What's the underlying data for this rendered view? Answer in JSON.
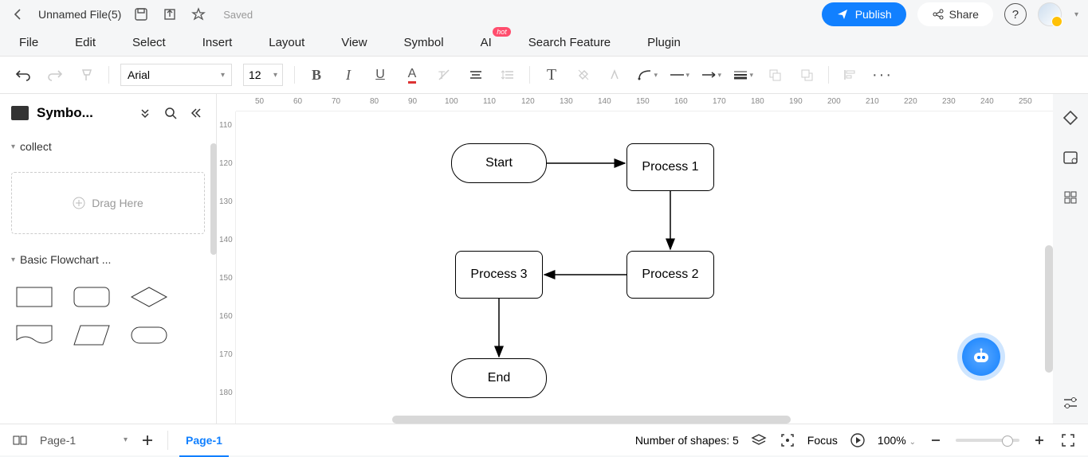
{
  "titlebar": {
    "filename": "Unnamed File(5)",
    "saved_label": "Saved",
    "publish_label": "Publish",
    "share_label": "Share"
  },
  "menu": {
    "items": [
      "File",
      "Edit",
      "Select",
      "Insert",
      "Layout",
      "View",
      "Symbol",
      "AI",
      "Search Feature",
      "Plugin"
    ],
    "ai_badge": "hot"
  },
  "toolbar": {
    "font_name": "Arial",
    "font_size": "12"
  },
  "left_panel": {
    "title": "Symbo...",
    "sections": {
      "collect": "collect",
      "drag_here": "Drag Here",
      "basic_flowchart": "Basic Flowchart ..."
    }
  },
  "ruler_h": [
    "50",
    "60",
    "70",
    "80",
    "90",
    "100",
    "110",
    "120",
    "130",
    "140",
    "150",
    "160",
    "170",
    "180",
    "190",
    "200",
    "210",
    "220",
    "230",
    "240",
    "250"
  ],
  "ruler_v": [
    "110",
    "120",
    "130",
    "140",
    "150",
    "160",
    "170",
    "180"
  ],
  "flowchart": {
    "shapes": {
      "start": "Start",
      "process1": "Process 1",
      "process2": "Process 2",
      "process3": "Process 3",
      "end": "End"
    }
  },
  "bottom": {
    "page_select": "Page-1",
    "active_tab": "Page-1",
    "shape_count": "Number of shapes: 5",
    "focus_label": "Focus",
    "zoom": "100%"
  }
}
